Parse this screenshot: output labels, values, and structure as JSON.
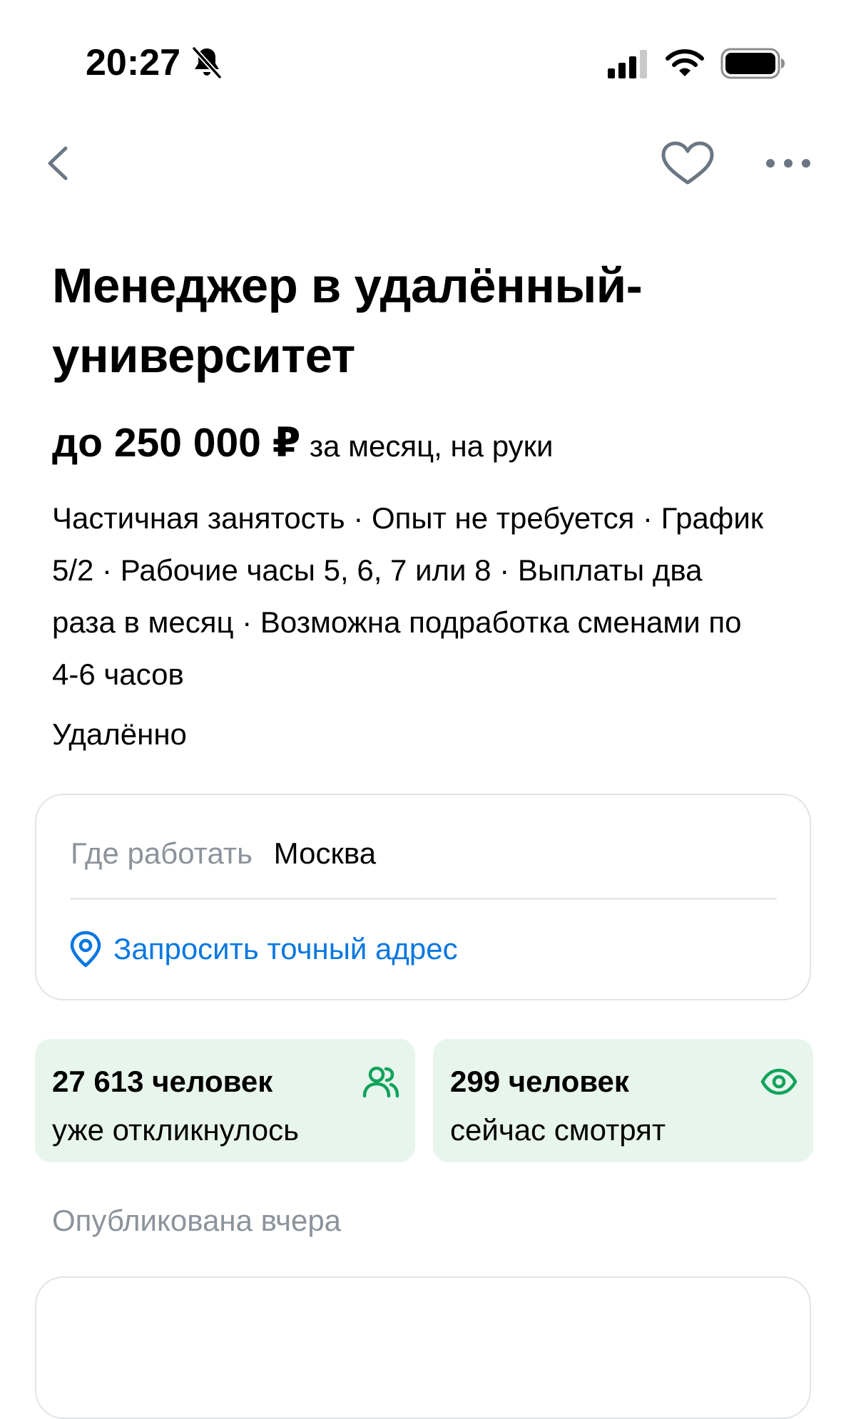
{
  "status_bar": {
    "time": "20:27",
    "icons": [
      "bell-off-icon",
      "cellular-signal-icon",
      "wifi-icon",
      "battery-icon"
    ]
  },
  "nav": {
    "back_icon": "chevron-left-icon",
    "favorite_icon": "heart-icon",
    "more_icon": "more-horizontal-icon"
  },
  "vacancy": {
    "title": "Менеджер в удалённый-университет",
    "salary_amount": "до 250 000 ₽",
    "salary_note": "за месяц, на руки",
    "conditions": "Частичная занятость · Опыт не требуется · График 5/2 · Рабочие часы 5, 6, 7 или 8 · Выплаты два раза в месяц · Возможна подработка сменами по 4-6 часов",
    "work_format": "Удалённо"
  },
  "location": {
    "label": "Где работать",
    "value": "Москва",
    "link_label": "Запросить точный адрес",
    "link_icon": "location-pin-icon"
  },
  "stats": {
    "responded_value": "27 613 человек",
    "responded_caption": "уже откликнулось",
    "responded_icon": "users-icon",
    "watching_value": "299 человек",
    "watching_caption": "сейчас смотрят",
    "watching_icon": "eye-icon"
  },
  "published": "Опубликована вчера",
  "colors": {
    "accent_blue": "#0a77e1",
    "accent_green": "#11a35b",
    "stat_background": "#e8f5ed",
    "muted_text": "#8b939c",
    "card_border": "#dfe3e8",
    "nav_icon": "#6a7683"
  }
}
